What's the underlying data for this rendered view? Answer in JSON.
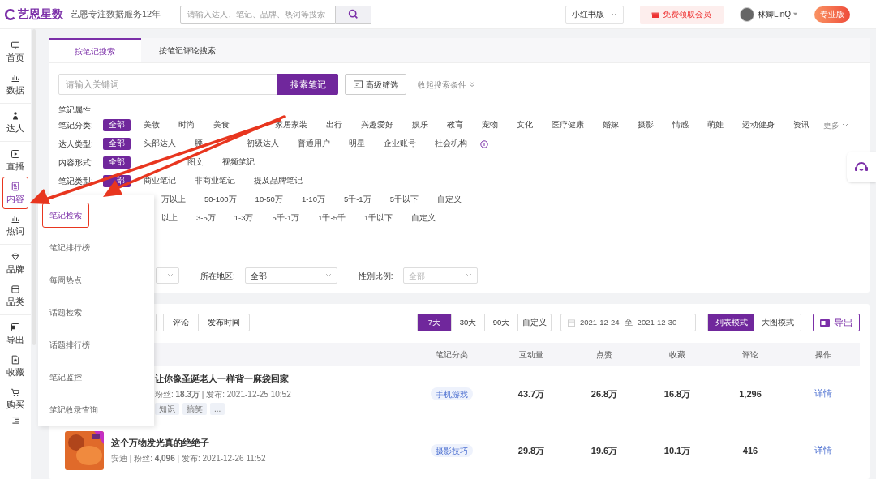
{
  "header": {
    "logo": "艺恩星数",
    "slogan": "艺恩专注数据服务12年",
    "search_placeholder": "请输入达人、笔记、品牌、热词等搜索",
    "platform": "小红书版",
    "promo": "免费领取会员",
    "user": "林卿LinQ",
    "plan": "专业版"
  },
  "sidebar": {
    "items": [
      {
        "label": "首页",
        "selected": false,
        "highlighted": false
      },
      {
        "label": "数据",
        "selected": false,
        "highlighted": false
      },
      {
        "label": "达人",
        "selected": false,
        "highlighted": false
      },
      {
        "label": "直播",
        "selected": false,
        "highlighted": false
      },
      {
        "label": "内容",
        "selected": true,
        "highlighted": true
      },
      {
        "label": "热词",
        "selected": false,
        "highlighted": false
      },
      {
        "label": "品牌",
        "selected": false,
        "highlighted": false
      },
      {
        "label": "品类",
        "selected": false,
        "highlighted": false
      },
      {
        "label": "导出",
        "selected": false,
        "highlighted": false
      },
      {
        "label": "收藏",
        "selected": false,
        "highlighted": false
      },
      {
        "label": "购买",
        "selected": false,
        "highlighted": false
      }
    ]
  },
  "submenu": [
    {
      "label": "笔记检索",
      "selected": true,
      "highlighted": true
    },
    {
      "label": "笔记排行榜",
      "selected": false,
      "highlighted": false
    },
    {
      "label": "每周热点",
      "selected": false,
      "highlighted": false
    },
    {
      "label": "话题检索",
      "selected": false,
      "highlighted": false
    },
    {
      "label": "话题排行榜",
      "selected": false,
      "highlighted": false
    },
    {
      "label": "笔记监控",
      "selected": false,
      "highlighted": false
    },
    {
      "label": "笔记收录查询",
      "selected": false,
      "highlighted": false
    }
  ],
  "tabs": [
    {
      "label": "按笔记搜索",
      "selected": true
    },
    {
      "label": "按笔记评论搜索",
      "selected": false
    }
  ],
  "search": {
    "placeholder": "请输入关键词",
    "button": "搜索笔记",
    "advanced": "高级筛选",
    "collapse": "收起搜索条件"
  },
  "filters": {
    "title": "笔记属性",
    "more": "更多",
    "rows": [
      {
        "label": "笔记分类:",
        "options": [
          {
            "label": "全部",
            "selected": true
          },
          {
            "label": "美妆",
            "selected": false
          },
          {
            "label": "时尚",
            "selected": false
          },
          {
            "label": "美食",
            "selected": false
          },
          {
            "label": "家居家装",
            "selected": false
          },
          {
            "label": "出行",
            "selected": false
          },
          {
            "label": "兴趣爱好",
            "selected": false
          },
          {
            "label": "娱乐",
            "selected": false
          },
          {
            "label": "教育",
            "selected": false
          },
          {
            "label": "宠物",
            "selected": false
          },
          {
            "label": "文化",
            "selected": false
          },
          {
            "label": "医疗健康",
            "selected": false
          },
          {
            "label": "婚嫁",
            "selected": false
          },
          {
            "label": "摄影",
            "selected": false
          },
          {
            "label": "情感",
            "selected": false
          },
          {
            "label": "萌娃",
            "selected": false
          },
          {
            "label": "运动健身",
            "selected": false
          },
          {
            "label": "资讯",
            "selected": false
          }
        ]
      },
      {
        "label": "达人类型:",
        "options": [
          {
            "label": "全部",
            "selected": true
          },
          {
            "label": "头部达人",
            "selected": false
          },
          {
            "label": "腰",
            "selected": false
          },
          {
            "label": "初级达人",
            "selected": false
          },
          {
            "label": "普通用户",
            "selected": false
          },
          {
            "label": "明星",
            "selected": false
          },
          {
            "label": "企业账号",
            "selected": false
          },
          {
            "label": "社会机构",
            "selected": false
          }
        ]
      },
      {
        "label": "内容形式:",
        "options": [
          {
            "label": "全部",
            "selected": true
          },
          {
            "label": "图文",
            "selected": false
          },
          {
            "label": "视频笔记",
            "selected": false
          }
        ]
      },
      {
        "label": "笔记类型:",
        "options": [
          {
            "label": "部",
            "selected": true
          },
          {
            "label": "商业笔记",
            "selected": false
          },
          {
            "label": "非商业笔记",
            "selected": false
          },
          {
            "label": "提及品牌笔记",
            "selected": false
          }
        ]
      },
      {
        "options": [
          {
            "label": "万以上",
            "selected": false
          },
          {
            "label": "50-100万",
            "selected": false
          },
          {
            "label": "10-50万",
            "selected": false
          },
          {
            "label": "1-10万",
            "selected": false
          },
          {
            "label": "5千-1万",
            "selected": false
          },
          {
            "label": "5千以下",
            "selected": false
          },
          {
            "label": "自定义",
            "selected": false
          }
        ]
      },
      {
        "options": [
          {
            "label": "以上",
            "selected": false
          },
          {
            "label": "3-5万",
            "selected": false
          },
          {
            "label": "1-3万",
            "selected": false
          },
          {
            "label": "5千-1万",
            "selected": false
          },
          {
            "label": "1千-5千",
            "selected": false
          },
          {
            "label": "1千以下",
            "selected": false
          },
          {
            "label": "自定义",
            "selected": false
          }
        ]
      }
    ],
    "selects": [
      {
        "label": "所在地区:",
        "value": "全部",
        "placeholder": false
      },
      {
        "label": "性别比例:",
        "value": "全部",
        "placeholder": true
      }
    ]
  },
  "toolbar": {
    "sort": [
      "评论",
      "发布时间"
    ],
    "ranges": [
      {
        "label": "7天",
        "selected": true
      },
      {
        "label": "30天",
        "selected": false
      },
      {
        "label": "90天",
        "selected": false
      },
      {
        "label": "自定义",
        "selected": false
      }
    ],
    "date_from": "2021-12-24",
    "date_sep": "至",
    "date_to": "2021-12-30",
    "views": [
      {
        "label": "列表模式",
        "selected": true
      },
      {
        "label": "大图模式",
        "selected": false
      }
    ],
    "export": "导出"
  },
  "table": {
    "columns": [
      "笔记分类",
      "互动量",
      "点赞",
      "收藏",
      "评论",
      "操作"
    ],
    "rows": [
      {
        "title": "让你像圣诞老人一样背一麻袋回家",
        "meta": "粉丝: **18.3万** | 发布: 2021-12-25 10:52",
        "tags": [
          "知识",
          "搞笑",
          "..."
        ],
        "category": "手机游戏",
        "interactions": "43.7万",
        "likes": "26.8万",
        "saves": "16.8万",
        "comments": "1,296",
        "action": "详情"
      },
      {
        "title": "这个万物发光真的绝绝子",
        "meta": "安迪 | 粉丝: **4,096** | 发布: 2021-12-26 11:52",
        "tags": [],
        "category": "摄影技巧",
        "interactions": "29.8万",
        "likes": "19.6万",
        "saves": "10.1万",
        "comments": "416",
        "action": "详情"
      }
    ]
  },
  "annotations": [
    {
      "kind": "arrow"
    },
    {
      "kind": "arrow"
    }
  ]
}
